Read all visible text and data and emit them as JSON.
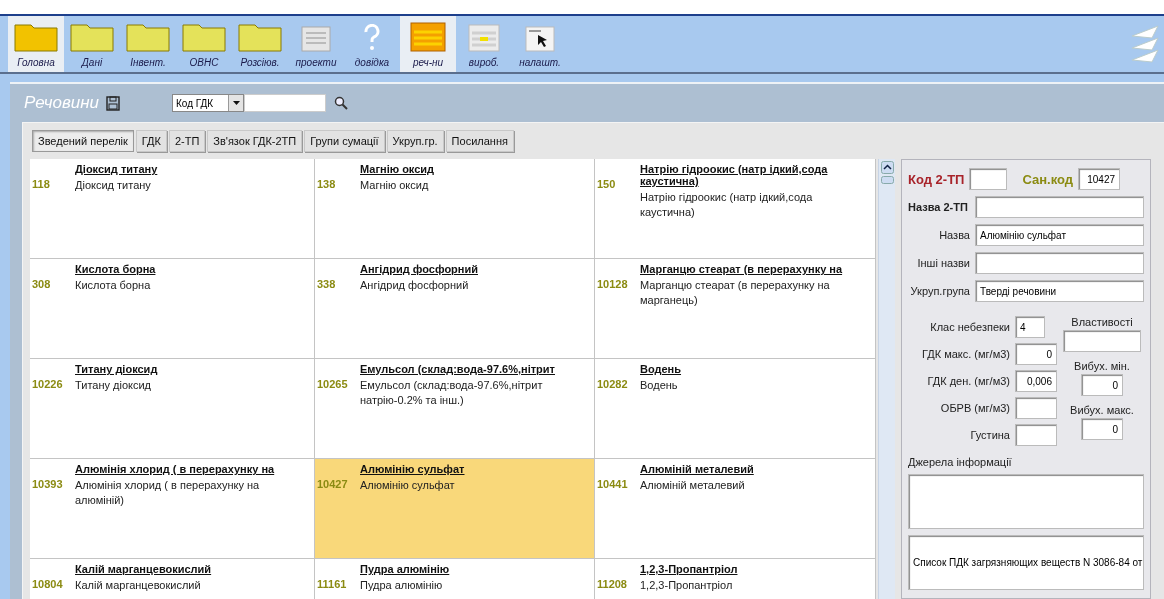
{
  "toolbar": [
    {
      "label": "Головна",
      "kind": "folder-main",
      "selected": true
    },
    {
      "label": "Дані",
      "kind": "folder",
      "selected": false
    },
    {
      "label": "Інвент.",
      "kind": "folder",
      "selected": false
    },
    {
      "label": "ОВНС",
      "kind": "folder",
      "selected": false
    },
    {
      "label": "Розсіюв.",
      "kind": "folder",
      "selected": false
    },
    {
      "label": "проекти",
      "kind": "list",
      "selected": false
    },
    {
      "label": "довідка",
      "kind": "help",
      "selected": false
    },
    {
      "label": "реч-ни",
      "kind": "table-orange",
      "selected": true
    },
    {
      "label": "вироб.",
      "kind": "table",
      "selected": false
    },
    {
      "label": "налашт.",
      "kind": "cursor",
      "selected": false
    }
  ],
  "panel": {
    "title": "Речовини",
    "search_by": "Код ГДК"
  },
  "tabs": [
    {
      "label": "Зведений перелік",
      "selected": true
    },
    {
      "label": "ГДК",
      "selected": false
    },
    {
      "label": "2-ТП",
      "selected": false
    },
    {
      "label": "Зв'язок ГДК-2ТП",
      "selected": false
    },
    {
      "label": "Групи сумації",
      "selected": false
    },
    {
      "label": "Укруп.гр.",
      "selected": false
    },
    {
      "label": "Посилання",
      "selected": false
    }
  ],
  "substances": [
    {
      "code": "118",
      "title": "Діоксид титану",
      "name": "Діоксид титану",
      "selected": false
    },
    {
      "code": "138",
      "title": "Магнію оксид",
      "name": "Магнію оксид",
      "selected": false
    },
    {
      "code": "150",
      "title": "Натрію гідроокис (натр ідкий,сода каустична)",
      "name": "Натрію гідроокис (натр ідкий,сода каустична)",
      "selected": false
    },
    {
      "code": "308",
      "title": "Кислота борна",
      "name": "Кислота борна",
      "selected": false
    },
    {
      "code": "338",
      "title": "Ангідрид фосфорний",
      "name": "Ангідрид фосфорний",
      "selected": false
    },
    {
      "code": "10128",
      "title": "Марганцю стеарат (в перерахунку на",
      "name": "Марганцю стеарат (в перерахунку на марганець)",
      "selected": false
    },
    {
      "code": "10226",
      "title": "Титану діоксид",
      "name": "Титану діоксид",
      "selected": false
    },
    {
      "code": "10265",
      "title": "Емульсол (склад:вода-97.6%,нітрит",
      "name": "Емульсол (склад:вода-97.6%,нітрит натрію-0.2% та інш.)",
      "selected": false
    },
    {
      "code": "10282",
      "title": "Водень",
      "name": "Водень",
      "selected": false
    },
    {
      "code": "10393",
      "title": "Алюмінія хлорид ( в перерахунку на",
      "name": "Алюмінія хлорид ( в перерахунку на алюміній)",
      "selected": false
    },
    {
      "code": "10427",
      "title": "Алюмінію сульфат",
      "name": "Алюмінію сульфат",
      "selected": true
    },
    {
      "code": "10441",
      "title": "Алюміній металевий",
      "name": "Алюміній металевий",
      "selected": false
    },
    {
      "code": "10804",
      "title": "Калій марганцевокислий",
      "name": "Калій марганцевокислий",
      "selected": false
    },
    {
      "code": "11161",
      "title": "Пудра алюмінію",
      "name": "Пудра алюмінію",
      "selected": false
    },
    {
      "code": "11208",
      "title": "1,2,3-Пропантріол",
      "name": "1,2,3-Пропантріол",
      "selected": false
    }
  ],
  "form": {
    "code_2tp": {
      "label": "Код 2-ТП"
    },
    "san_code": {
      "label": "Сан.код",
      "value": "10427"
    },
    "name_2tp": {
      "label": "Назва 2-ТП"
    },
    "fields": [
      {
        "label": "Назва",
        "value": "Алюмінію сульфат"
      },
      {
        "label": "Інші назви"
      },
      {
        "label": "Укруп.група",
        "value": "Тверді речовини"
      }
    ],
    "left": [
      {
        "label": "Клас небезпеки",
        "value": "4"
      },
      {
        "label": "ГДК макс. (мг/м3)",
        "value": "0"
      },
      {
        "label": "ГДК ден. (мг/м3)",
        "value": "0,006"
      },
      {
        "label": "ОБРВ (мг/м3)"
      },
      {
        "label": "Густина"
      }
    ],
    "right": [
      {
        "label": "Властивості"
      },
      {
        "label": "Вибух. мін.",
        "value": "0"
      },
      {
        "label": "Вибух. макс.",
        "value": "0"
      }
    ],
    "sources": {
      "label": "Джерела інформації",
      "value": "Список ПДК загрязняющих веществ N 3086-84 от"
    }
  }
}
